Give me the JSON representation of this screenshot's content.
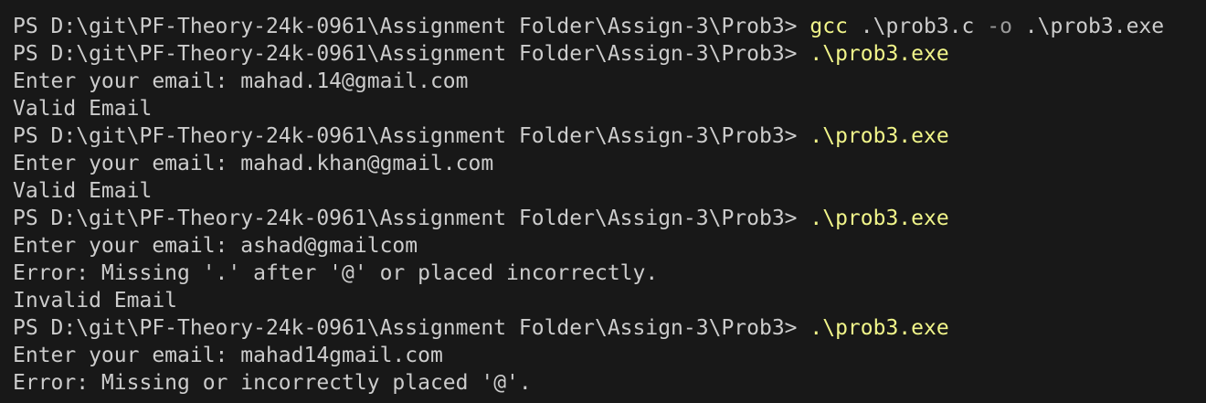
{
  "terminal": {
    "prompt": "PS D:\\git\\PF-Theory-24k-0961\\Assignment Folder\\Assign-3\\Prob3> ",
    "lines": [
      {
        "type": "command",
        "cmd": "gcc",
        "args": [
          " .\\prob3.c ",
          "-o",
          " .\\prob3.exe"
        ]
      },
      {
        "type": "command",
        "cmd": ".\\prob3.exe"
      },
      {
        "type": "output",
        "text": "Enter your email: mahad.14@gmail.com"
      },
      {
        "type": "output",
        "text": "Valid Email"
      },
      {
        "type": "command",
        "cmd": ".\\prob3.exe"
      },
      {
        "type": "output",
        "text": "Enter your email: mahad.khan@gmail.com"
      },
      {
        "type": "output",
        "text": "Valid Email"
      },
      {
        "type": "command",
        "cmd": ".\\prob3.exe"
      },
      {
        "type": "output",
        "text": "Enter your email: ashad@gmailcom"
      },
      {
        "type": "output",
        "text": "Error: Missing '.' after '@' or placed incorrectly."
      },
      {
        "type": "output",
        "text": "Invalid Email"
      },
      {
        "type": "command",
        "cmd": ".\\prob3.exe"
      },
      {
        "type": "output",
        "text": "Enter your email: mahad14gmail.com"
      },
      {
        "type": "output",
        "text": "Error: Missing or incorrectly placed '@'."
      }
    ]
  },
  "colors": {
    "background": "#181818",
    "text": "#cccccc",
    "command": "#f1f58a",
    "flag": "#9a9a9a"
  }
}
